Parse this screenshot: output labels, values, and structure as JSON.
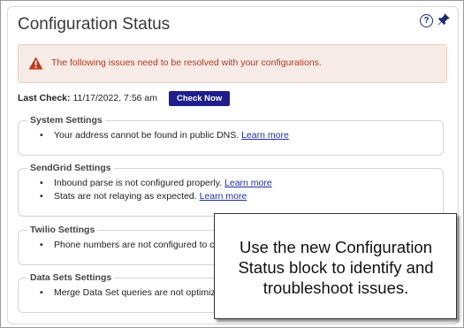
{
  "panel": {
    "title": "Configuration Status",
    "help_label": "?"
  },
  "alert": {
    "message": "The following issues need to be resolved with your configurations.",
    "color": "#b23a1e"
  },
  "last_check": {
    "label": "Last Check:",
    "value": "11/17/2022, 7:56 am",
    "button_label": "Check Now"
  },
  "sections": [
    {
      "title": "System Settings",
      "items": [
        {
          "text": "Your address cannot be found in public DNS.",
          "link": "Learn more"
        }
      ]
    },
    {
      "title": "SendGrid Settings",
      "items": [
        {
          "text": "Inbound parse is not configured properly.",
          "link": "Learn more"
        },
        {
          "text": "Stats are not relaying as expected.",
          "link": "Learn more"
        }
      ]
    },
    {
      "title": "Twilio Settings",
      "items": [
        {
          "text": "Phone numbers are not configured to co",
          "link": ""
        }
      ]
    },
    {
      "title": "Data Sets Settings",
      "items": [
        {
          "text": "Merge Data Set queries are not optimiz",
          "link": ""
        }
      ]
    }
  ],
  "callout": {
    "text": "Use the new Configuration Status block to identify and troubleshoot issues."
  },
  "colors": {
    "button": "#1e1f8c",
    "link": "#1e2fa0"
  }
}
